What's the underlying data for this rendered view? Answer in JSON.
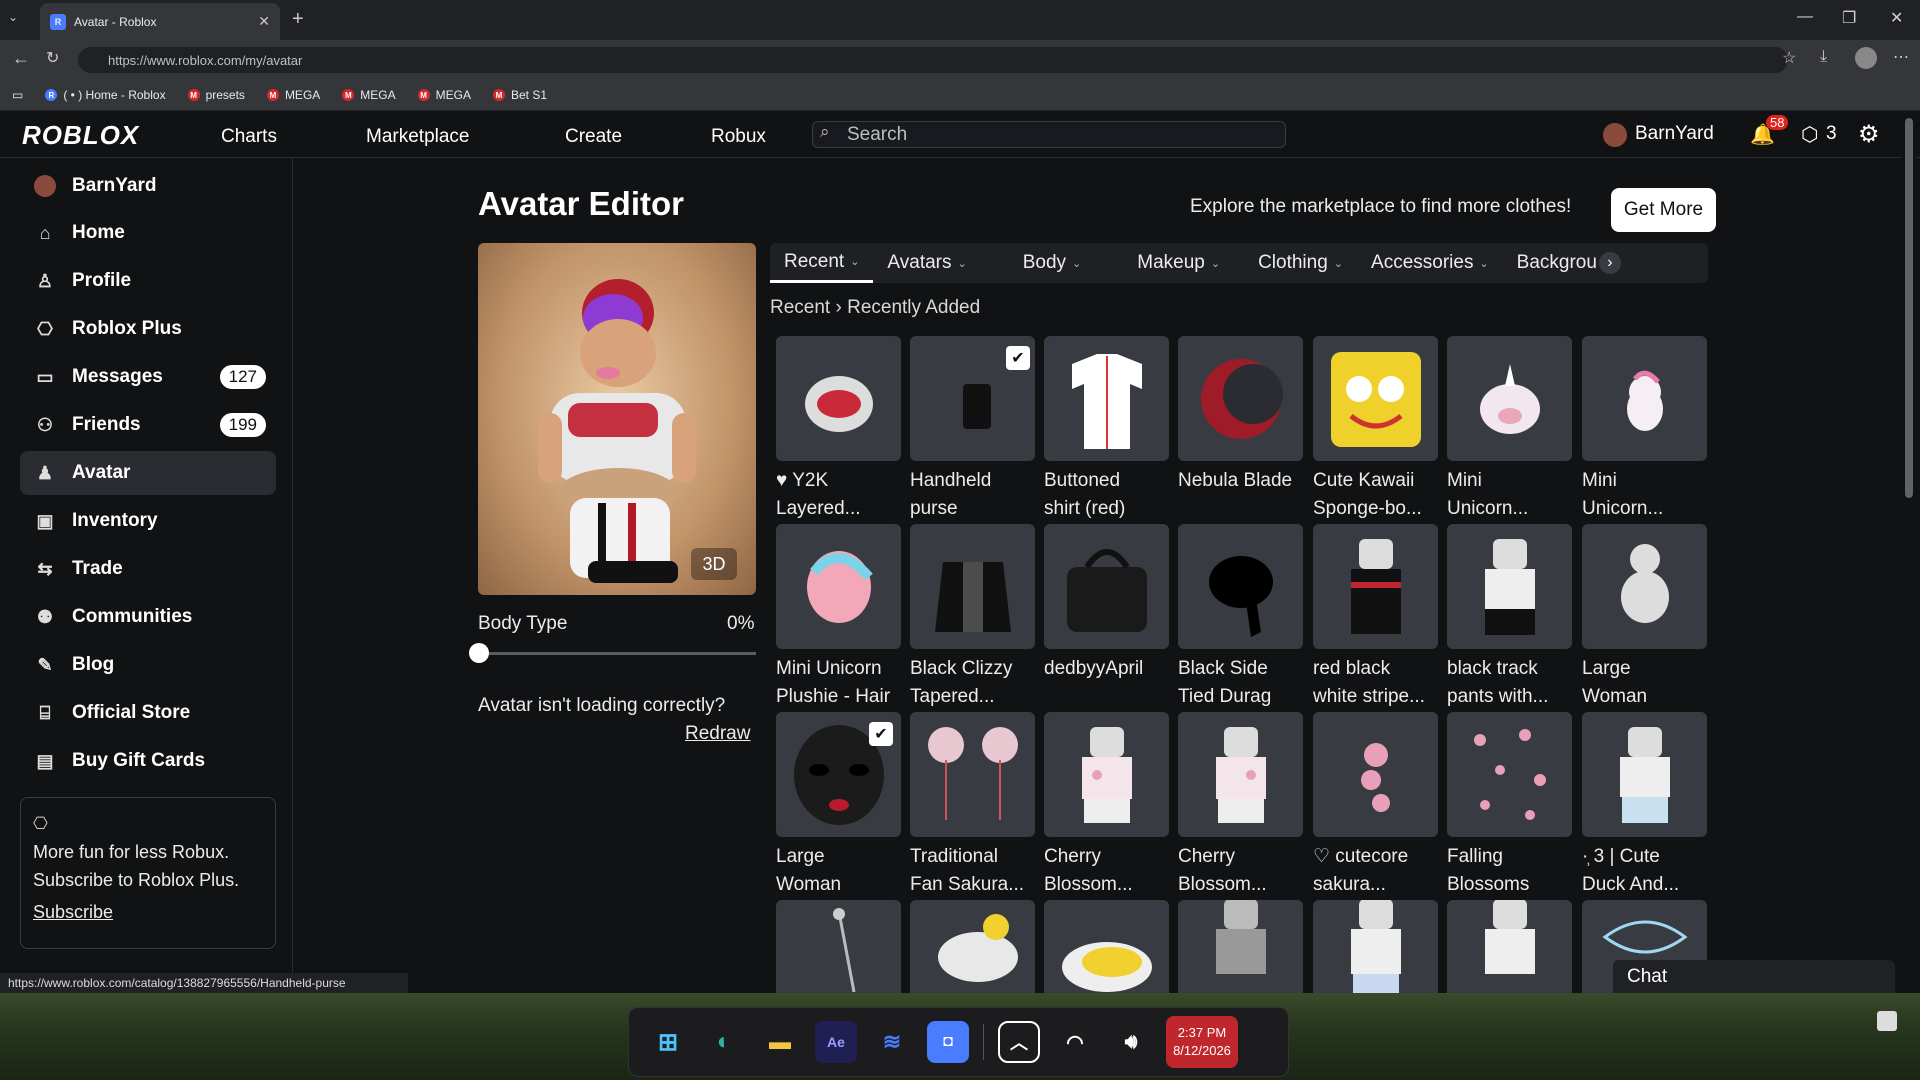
{
  "browser": {
    "tab_title": "Roblox",
    "tab_title_full": "Avatar - Roblox",
    "url": "https://www.roblox.com/my/avatar",
    "bookmarks": [
      {
        "label": "( • ) Home - Roblox"
      },
      {
        "label": "presets"
      },
      {
        "label": "MEGA"
      },
      {
        "label": "MEGA"
      },
      {
        "label": "MEGA"
      },
      {
        "label": "Bet S1"
      }
    ],
    "status_url": "https://www.roblox.com/catalog/138827965556/Handheld-purse"
  },
  "nav": {
    "logo": "ROBLOX",
    "links": [
      "Charts",
      "Marketplace",
      "Create",
      "Robux"
    ],
    "search_placeholder": "Search",
    "username": "BarnYard",
    "notif_count": "58",
    "robux_count": "3"
  },
  "sidebar": {
    "user": "BarnYard",
    "items": [
      {
        "label": "Home",
        "icon": "home-icon"
      },
      {
        "label": "Profile",
        "icon": "profile-icon"
      },
      {
        "label": "Roblox Plus",
        "icon": "plus-icon"
      },
      {
        "label": "Messages",
        "icon": "messages-icon",
        "badge": "127"
      },
      {
        "label": "Friends",
        "icon": "friends-icon",
        "badge": "199"
      },
      {
        "label": "Avatar",
        "icon": "avatar-icon",
        "active": true
      },
      {
        "label": "Inventory",
        "icon": "inventory-icon"
      },
      {
        "label": "Trade",
        "icon": "trade-icon"
      },
      {
        "label": "Communities",
        "icon": "communities-icon"
      },
      {
        "label": "Blog",
        "icon": "blog-icon"
      },
      {
        "label": "Official Store",
        "icon": "store-icon"
      },
      {
        "label": "Buy Gift Cards",
        "icon": "giftcard-icon"
      }
    ],
    "promo_text1": "More fun for less Robux.",
    "promo_text2": "Subscribe to Roblox Plus.",
    "promo_link": "Subscribe"
  },
  "main": {
    "title": "Avatar Editor",
    "explore": "Explore the marketplace to find more clothes!",
    "get_more": "Get More",
    "btn_3d": "3D",
    "body_type": "Body Type",
    "body_pct": "0%",
    "loading_msg": "Avatar isn't loading correctly?",
    "redraw": "Redraw",
    "tabs": [
      "Recent",
      "Avatars",
      "Body",
      "Makeup",
      "Clothing",
      "Accessories",
      "Backgrou"
    ],
    "crumb_root": "Recent",
    "crumb_leaf": "Recently Added",
    "chat": "Chat"
  },
  "items": [
    {
      "l1": "♥ Y2K",
      "l2": "Layered..."
    },
    {
      "l1": "Handheld",
      "l2": "purse",
      "checked": true
    },
    {
      "l1": "Buttoned",
      "l2": "shirt (red)"
    },
    {
      "l1": "Nebula Blade",
      "l2": ""
    },
    {
      "l1": "Cute Kawaii",
      "l2": "Sponge-bo..."
    },
    {
      "l1": "Mini",
      "l2": "Unicorn..."
    },
    {
      "l1": "Mini",
      "l2": "Unicorn..."
    },
    {
      "l1": "Mini Unicorn",
      "l2": "Plushie - Hair"
    },
    {
      "l1": "Black Clizzy",
      "l2": "Tapered..."
    },
    {
      "l1": "dedbyyApril",
      "l2": ""
    },
    {
      "l1": "Black Side",
      "l2": "Tied Durag"
    },
    {
      "l1": "red black",
      "l2": "white stripe..."
    },
    {
      "l1": "black track",
      "l2": "pants with..."
    },
    {
      "l1": "Large",
      "l2": "Woman"
    },
    {
      "l1": "Large",
      "l2": "Woman",
      "checked": true
    },
    {
      "l1": "Traditional",
      "l2": "Fan Sakura..."
    },
    {
      "l1": "Cherry",
      "l2": "Blossom..."
    },
    {
      "l1": "Cherry",
      "l2": "Blossom..."
    },
    {
      "l1": "♡ cutecore",
      "l2": "sakura..."
    },
    {
      "l1": "Falling",
      "l2": "Blossoms"
    },
    {
      "l1": "·̹ 3 | Cute",
      "l2": "Duck And..."
    }
  ],
  "taskbar": {
    "time": "2:37 PM",
    "date": "8/12/2026"
  }
}
